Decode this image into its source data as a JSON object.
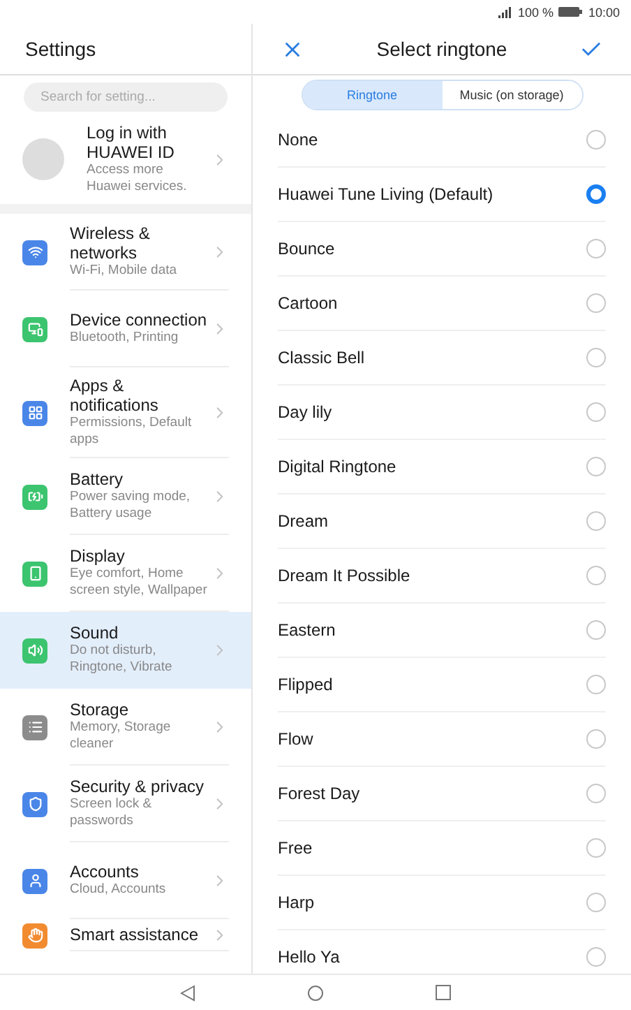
{
  "status_bar": {
    "battery": "100 %",
    "time": "10:00"
  },
  "settings": {
    "title": "Settings",
    "search": {
      "placeholder": "Search for setting..."
    },
    "account": {
      "title": "Log in with HUAWEI ID",
      "subtitle": "Access more Huawei services."
    },
    "items": [
      {
        "title": "Wireless & networks",
        "subtitle": "Wi-Fi, Mobile data",
        "selected": false
      },
      {
        "title": "Device connection",
        "subtitle": "Bluetooth, Printing",
        "selected": false
      },
      {
        "title": "Apps & notifications",
        "subtitle": "Permissions, Default apps",
        "selected": false
      },
      {
        "title": "Battery",
        "subtitle": "Power saving mode, Battery usage",
        "selected": false
      },
      {
        "title": "Display",
        "subtitle": "Eye comfort, Home screen style, Wallpaper",
        "selected": false
      },
      {
        "title": "Sound",
        "subtitle": "Do not disturb, Ringtone, Vibrate",
        "selected": true
      },
      {
        "title": "Storage",
        "subtitle": "Memory, Storage cleaner",
        "selected": false
      },
      {
        "title": "Security & privacy",
        "subtitle": "Screen lock & passwords",
        "selected": false
      },
      {
        "title": "Accounts",
        "subtitle": "Cloud, Accounts",
        "selected": false
      },
      {
        "title": "Smart assistance",
        "selected": false
      }
    ]
  },
  "ringtone": {
    "title": "Select ringtone",
    "tabs": [
      {
        "label": "Ringtone",
        "selected": true
      },
      {
        "label": "Music (on storage)",
        "selected": false
      }
    ],
    "options": [
      {
        "label": "None",
        "selected": false
      },
      {
        "label": "Huawei Tune Living (Default)",
        "selected": true
      },
      {
        "label": "Bounce",
        "selected": false
      },
      {
        "label": "Cartoon",
        "selected": false
      },
      {
        "label": "Classic Bell",
        "selected": false
      },
      {
        "label": "Day lily",
        "selected": false
      },
      {
        "label": "Digital Ringtone",
        "selected": false
      },
      {
        "label": "Dream",
        "selected": false
      },
      {
        "label": "Dream It Possible",
        "selected": false
      },
      {
        "label": "Eastern",
        "selected": false
      },
      {
        "label": "Flipped",
        "selected": false
      },
      {
        "label": "Flow",
        "selected": false
      },
      {
        "label": "Forest Day",
        "selected": false
      },
      {
        "label": "Free",
        "selected": false
      },
      {
        "label": "Harp",
        "selected": false
      },
      {
        "label": "Hello Ya",
        "selected": false
      }
    ]
  }
}
